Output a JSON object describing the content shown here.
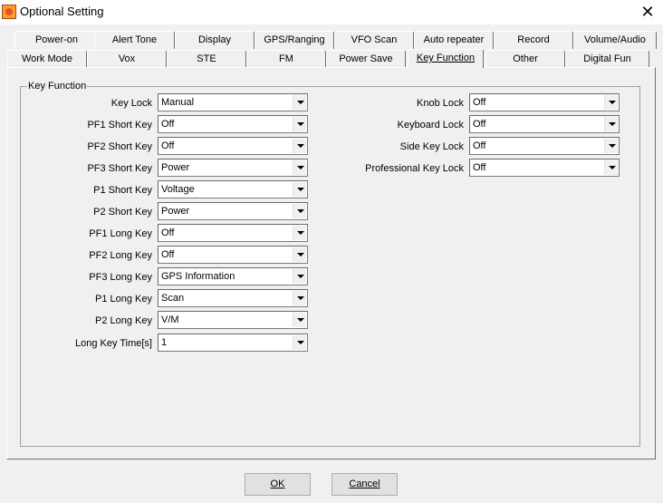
{
  "window": {
    "title": "Optional Setting",
    "close_glyph": "✕",
    "icon": "app-logo-icon"
  },
  "tabs_row1": [
    {
      "label": "Power-on"
    },
    {
      "label": "Alert Tone"
    },
    {
      "label": "Display"
    },
    {
      "label": "GPS/Ranging"
    },
    {
      "label": "VFO Scan"
    },
    {
      "label": "Auto repeater"
    },
    {
      "label": "Record"
    },
    {
      "label": "Volume/Audio"
    }
  ],
  "tabs_row2": [
    {
      "label": "Work Mode"
    },
    {
      "label": "Vox"
    },
    {
      "label": "STE"
    },
    {
      "label": "FM"
    },
    {
      "label": "Power Save"
    },
    {
      "label": "Key Function",
      "active": true
    },
    {
      "label": "Other"
    },
    {
      "label": "Digital Fun"
    }
  ],
  "group": {
    "title": "Key Function"
  },
  "left_fields": [
    {
      "label": "Key Lock",
      "value": "Manual"
    },
    {
      "label": "PF1 Short Key",
      "value": "Off"
    },
    {
      "label": "PF2 Short Key",
      "value": "Off"
    },
    {
      "label": "PF3 Short Key",
      "value": "Power"
    },
    {
      "label": "P1 Short Key",
      "value": "Voltage"
    },
    {
      "label": "P2 Short Key",
      "value": "Power"
    },
    {
      "label": "PF1 Long Key",
      "value": "Off"
    },
    {
      "label": "PF2 Long Key",
      "value": "Off"
    },
    {
      "label": "PF3 Long Key",
      "value": "GPS Information"
    },
    {
      "label": "P1 Long Key",
      "value": "Scan"
    },
    {
      "label": "P2 Long Key",
      "value": "V/M"
    },
    {
      "label": "Long Key Time[s]",
      "value": "1"
    }
  ],
  "right_fields": [
    {
      "label": "Knob Lock",
      "value": "Off"
    },
    {
      "label": "Keyboard Lock",
      "value": "Off"
    },
    {
      "label": "Side Key Lock",
      "value": "Off"
    },
    {
      "label": "Professional Key Lock",
      "value": "Off"
    }
  ],
  "buttons": {
    "ok": "OK",
    "cancel": "Cancel"
  }
}
